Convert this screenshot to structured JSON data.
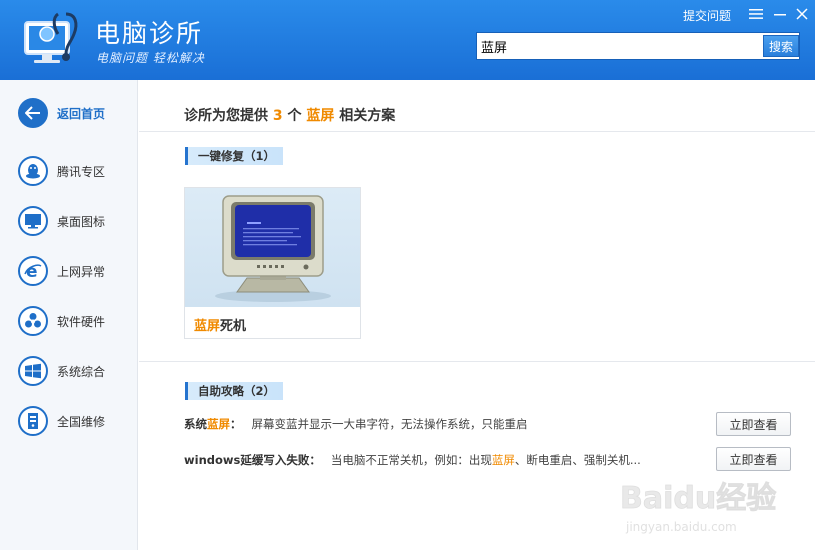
{
  "header": {
    "app_title": "电脑诊所",
    "app_slogan": "电脑问题 轻松解决",
    "submit_link": "提交问题",
    "menu_icon": "menu-icon",
    "minimize_icon": "minimize-icon",
    "close_icon": "close-icon",
    "brand_color": "#1a73d9"
  },
  "search": {
    "value": "蓝屏",
    "button_label": "搜索"
  },
  "sidebar": {
    "items": [
      {
        "label": "返回首页",
        "icon": "back-arrow-icon",
        "active": true
      },
      {
        "label": "腾讯专区",
        "icon": "qq-penguin-icon"
      },
      {
        "label": "桌面图标",
        "icon": "desktop-monitor-icon"
      },
      {
        "label": "上网异常",
        "icon": "ie-browser-icon"
      },
      {
        "label": "软件硬件",
        "icon": "hardware-icon"
      },
      {
        "label": "系统综合",
        "icon": "windows-logo-icon"
      },
      {
        "label": "全国维修",
        "icon": "repair-tower-icon"
      }
    ]
  },
  "summary": {
    "prefix": "诊所为您提供",
    "count": "3",
    "middle": "个",
    "keyword": "蓝屏",
    "suffix": "相关方案"
  },
  "one_click": {
    "section_label": "一键修复（1）",
    "card": {
      "keyword": "蓝屏",
      "rest": "死机",
      "image": "bsod-crt-monitor"
    }
  },
  "self_help": {
    "section_label": "自助攻略（2）",
    "items": [
      {
        "title_prefix": "系统",
        "title_keyword": "蓝屏",
        "title_suffix": "：",
        "desc_prefix": "屏幕变蓝并显示一大串字符，无法操作系统，只能重启",
        "desc_keyword": "",
        "desc_suffix": "",
        "button_label": "立即查看"
      },
      {
        "title_prefix": "windows延缓写入失败：",
        "title_keyword": "",
        "title_suffix": "",
        "desc_prefix": "当电脑不正常关机，例如：出现",
        "desc_keyword": "蓝屏",
        "desc_suffix": "、断电重启、强制关机...",
        "button_label": "立即查看"
      }
    ]
  },
  "watermark": {
    "brand": "Baidu经验",
    "url": "jingyan.baidu.com"
  }
}
